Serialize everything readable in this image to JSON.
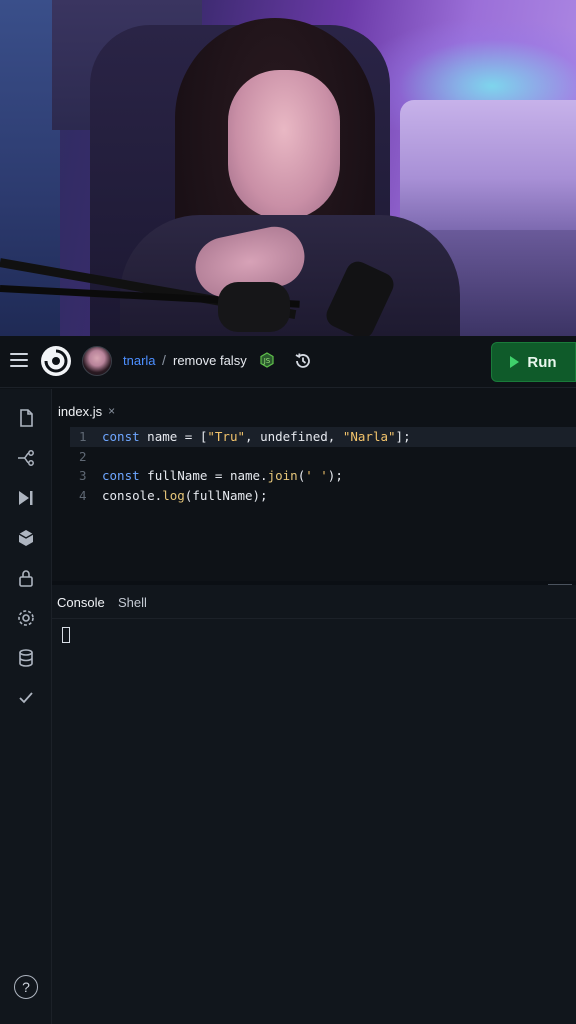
{
  "header": {
    "user": "tnarla",
    "separator": "/",
    "repl_name": "remove falsy",
    "run_label": "Run"
  },
  "editor": {
    "tab_label": "index.js",
    "tab_close": "×",
    "lines": [
      {
        "num": "1",
        "active": true,
        "tokens": [
          {
            "t": "kw",
            "v": "const"
          },
          {
            "t": "plain",
            "v": " name = ["
          },
          {
            "t": "str",
            "v": "\"Tru\""
          },
          {
            "t": "plain",
            "v": ", undefined, "
          },
          {
            "t": "str",
            "v": "\"Narla\""
          },
          {
            "t": "plain",
            "v": "];"
          }
        ]
      },
      {
        "num": "2",
        "active": false,
        "tokens": []
      },
      {
        "num": "3",
        "active": false,
        "tokens": [
          {
            "t": "kw",
            "v": "const"
          },
          {
            "t": "plain",
            "v": " fullName = name."
          },
          {
            "t": "fn",
            "v": "join"
          },
          {
            "t": "plain",
            "v": "("
          },
          {
            "t": "str",
            "v": "' '"
          },
          {
            "t": "plain",
            "v": ");"
          }
        ]
      },
      {
        "num": "4",
        "active": false,
        "tokens": [
          {
            "t": "plain",
            "v": "console."
          },
          {
            "t": "fn",
            "v": "log"
          },
          {
            "t": "plain",
            "v": "(fullName);"
          }
        ]
      }
    ]
  },
  "console": {
    "tabs": [
      "Console",
      "Shell"
    ]
  },
  "rail": {
    "icons": [
      "files-icon",
      "git-branch-icon",
      "debugger-icon",
      "packages-icon",
      "secrets-lock-icon",
      "settings-gear-icon",
      "database-icon",
      "checkmark-icon"
    ],
    "help_label": "?"
  },
  "colors": {
    "background": "#0e1217",
    "accent_run": "#0f5b2a",
    "link": "#4d8fff",
    "keyword": "#6ea6ff",
    "string": "#f2c36b"
  }
}
